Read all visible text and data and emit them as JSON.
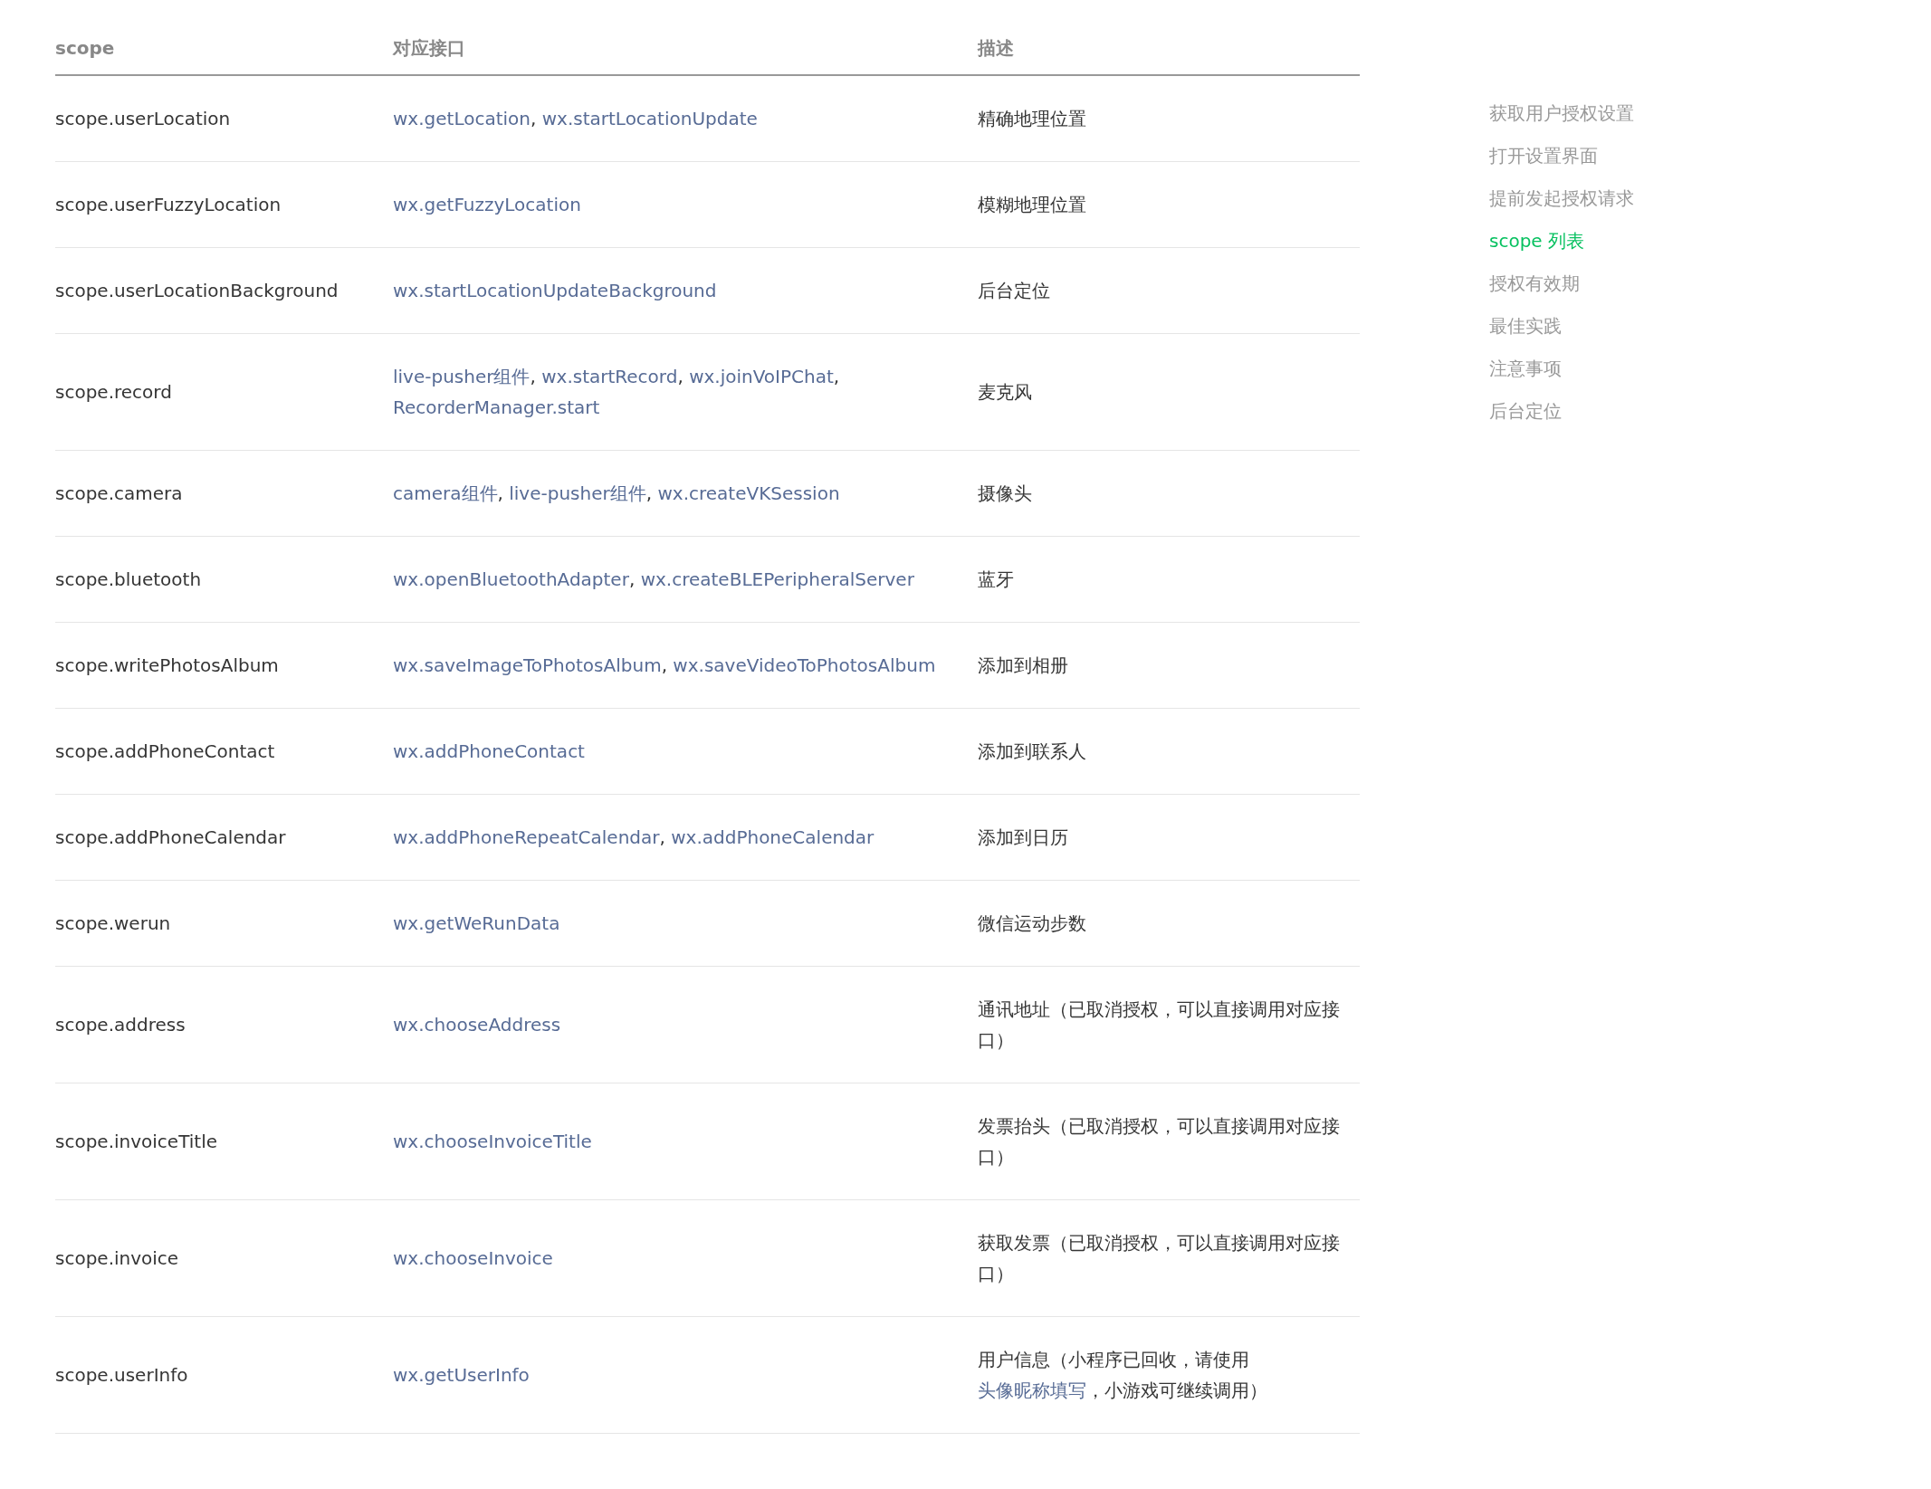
{
  "table": {
    "columns": [
      "scope",
      "对应接口",
      "描述"
    ],
    "rows": [
      {
        "scope": "scope.userLocation",
        "apis": [
          {
            "text": "wx.getLocation",
            "link": true
          },
          {
            "text": ", ",
            "link": false
          },
          {
            "text": "wx.startLocationUpdate",
            "link": true
          }
        ],
        "description": [
          {
            "text": "精确地理位置",
            "link": false
          }
        ]
      },
      {
        "scope": "scope.userFuzzyLocation",
        "apis": [
          {
            "text": "wx.getFuzzyLocation",
            "link": true
          }
        ],
        "description": [
          {
            "text": "模糊地理位置",
            "link": false
          }
        ]
      },
      {
        "scope": "scope.userLocationBackground",
        "apis": [
          {
            "text": "wx.startLocationUpdateBackground",
            "link": true
          }
        ],
        "description": [
          {
            "text": "后台定位",
            "link": false
          }
        ]
      },
      {
        "scope": "scope.record",
        "apis": [
          {
            "text": "live-pusher组件",
            "link": true
          },
          {
            "text": ", ",
            "link": false
          },
          {
            "text": "wx.startRecord",
            "link": true
          },
          {
            "text": ", ",
            "link": false
          },
          {
            "text": "wx.joinVoIPChat",
            "link": true
          },
          {
            "text": ", ",
            "link": false
          },
          {
            "text": "RecorderManager.start",
            "link": true
          }
        ],
        "description": [
          {
            "text": "麦克风",
            "link": false
          }
        ]
      },
      {
        "scope": "scope.camera",
        "apis": [
          {
            "text": "camera组件",
            "link": true
          },
          {
            "text": ", ",
            "link": false
          },
          {
            "text": "live-pusher组件",
            "link": true
          },
          {
            "text": ", ",
            "link": false
          },
          {
            "text": "wx.createVKSession",
            "link": true
          }
        ],
        "description": [
          {
            "text": "摄像头",
            "link": false
          }
        ]
      },
      {
        "scope": "scope.bluetooth",
        "apis": [
          {
            "text": "wx.openBluetoothAdapter",
            "link": true
          },
          {
            "text": ", ",
            "link": false
          },
          {
            "text": "wx.createBLEPeripheralServer",
            "link": true
          }
        ],
        "description": [
          {
            "text": "蓝牙",
            "link": false
          }
        ]
      },
      {
        "scope": "scope.writePhotosAlbum",
        "apis": [
          {
            "text": "wx.saveImageToPhotosAlbum",
            "link": true
          },
          {
            "text": ", ",
            "link": false
          },
          {
            "text": "wx.saveVideoToPhotosAlbum",
            "link": true
          }
        ],
        "description": [
          {
            "text": "添加到相册",
            "link": false
          }
        ]
      },
      {
        "scope": "scope.addPhoneContact",
        "apis": [
          {
            "text": "wx.addPhoneContact",
            "link": true
          }
        ],
        "description": [
          {
            "text": "添加到联系人",
            "link": false
          }
        ]
      },
      {
        "scope": "scope.addPhoneCalendar",
        "apis": [
          {
            "text": "wx.addPhoneRepeatCalendar",
            "link": true
          },
          {
            "text": ", ",
            "link": false
          },
          {
            "text": "wx.addPhoneCalendar",
            "link": true
          }
        ],
        "description": [
          {
            "text": "添加到日历",
            "link": false
          }
        ]
      },
      {
        "scope": "scope.werun",
        "apis": [
          {
            "text": "wx.getWeRunData",
            "link": true
          }
        ],
        "description": [
          {
            "text": "微信运动步数",
            "link": false
          }
        ]
      },
      {
        "scope": "scope.address",
        "apis": [
          {
            "text": "wx.chooseAddress",
            "link": true
          }
        ],
        "description": [
          {
            "text": "通讯地址（已取消授权，可以直接调用对应接口）",
            "link": false
          }
        ]
      },
      {
        "scope": "scope.invoiceTitle",
        "apis": [
          {
            "text": "wx.chooseInvoiceTitle",
            "link": true
          }
        ],
        "description": [
          {
            "text": "发票抬头（已取消授权，可以直接调用对应接口）",
            "link": false
          }
        ]
      },
      {
        "scope": "scope.invoice",
        "apis": [
          {
            "text": "wx.chooseInvoice",
            "link": true
          }
        ],
        "description": [
          {
            "text": "获取发票（已取消授权，可以直接调用对应接口）",
            "link": false
          }
        ]
      },
      {
        "scope": "scope.userInfo",
        "apis": [
          {
            "text": "wx.getUserInfo",
            "link": true
          }
        ],
        "description": [
          {
            "text": "用户信息（小程序已回收，请使用",
            "link": false
          },
          {
            "text": "头像昵称填写",
            "link": true
          },
          {
            "text": "，小游戏可继续调用）",
            "link": false
          }
        ]
      }
    ]
  },
  "toc": {
    "items": [
      {
        "label": "获取用户授权设置",
        "selected": false
      },
      {
        "label": "打开设置界面",
        "selected": false
      },
      {
        "label": "提前发起授权请求",
        "selected": false
      },
      {
        "label": "scope 列表",
        "selected": true
      },
      {
        "label": "授权有效期",
        "selected": false
      },
      {
        "label": "最佳实践",
        "selected": false
      },
      {
        "label": "注意事项",
        "selected": false
      },
      {
        "label": "后台定位",
        "selected": false
      }
    ]
  }
}
